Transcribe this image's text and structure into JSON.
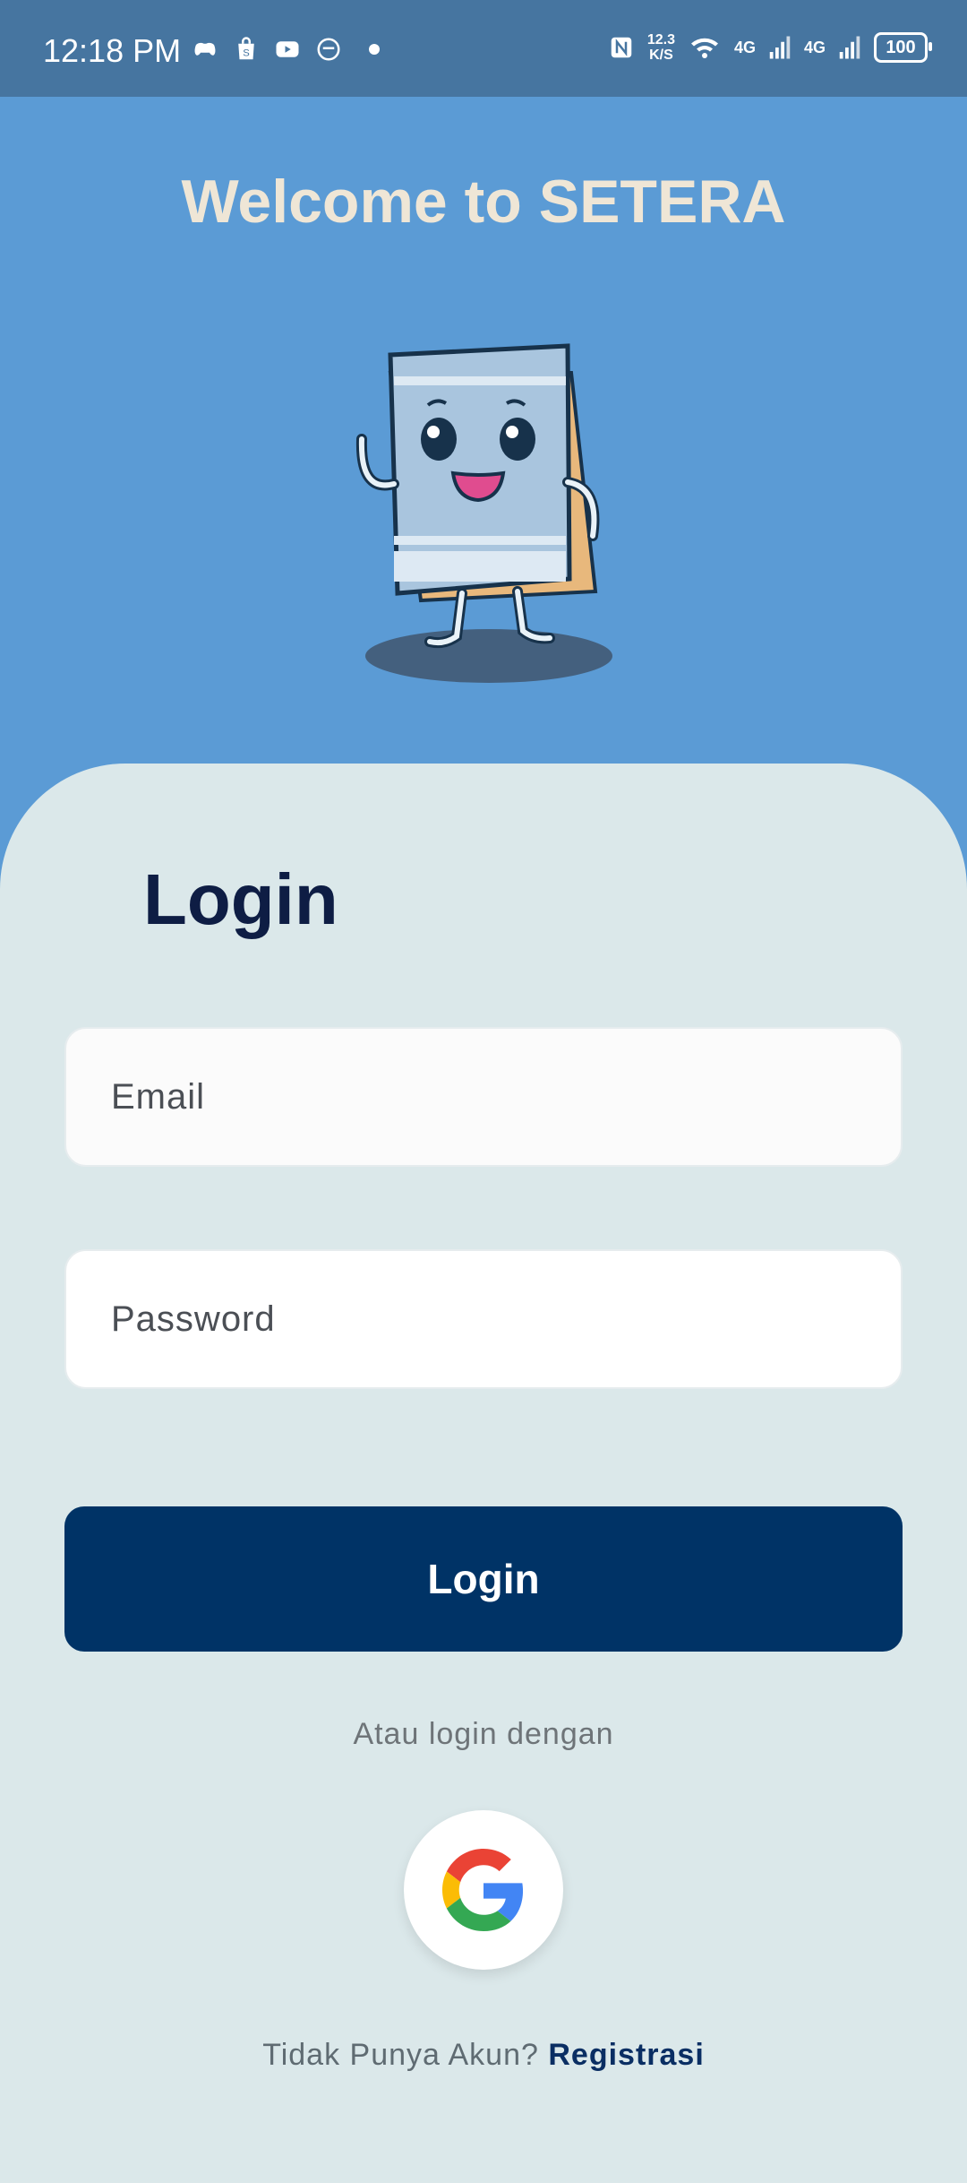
{
  "status_bar": {
    "time": "12:18 PM",
    "net_speed_value": "12.3",
    "net_speed_unit": "K/S",
    "network_1": "4G",
    "network_2": "4G",
    "battery": "100",
    "left_icons": [
      "game-controller-icon",
      "shopping-bag-icon",
      "youtube-icon",
      "smiley-app-icon",
      "notification-dot"
    ],
    "right_icons": [
      "nfc-icon",
      "wifi-icon",
      "signal-icon",
      "signal-icon",
      "battery-icon"
    ]
  },
  "header": {
    "welcome_text": "Welcome to SETERA"
  },
  "login": {
    "title": "Login",
    "email_placeholder": "Email",
    "password_placeholder": "Password",
    "submit_label": "Login",
    "alt_login_text": "Atau login dengan",
    "no_account_text": "Tidak Punya Akun?",
    "register_link": "Registrasi"
  },
  "colors": {
    "primary": "#003366",
    "header_bg": "#5b9bd5",
    "card_bg": "#dbe8ea",
    "welcome_text": "#efe6d6"
  }
}
